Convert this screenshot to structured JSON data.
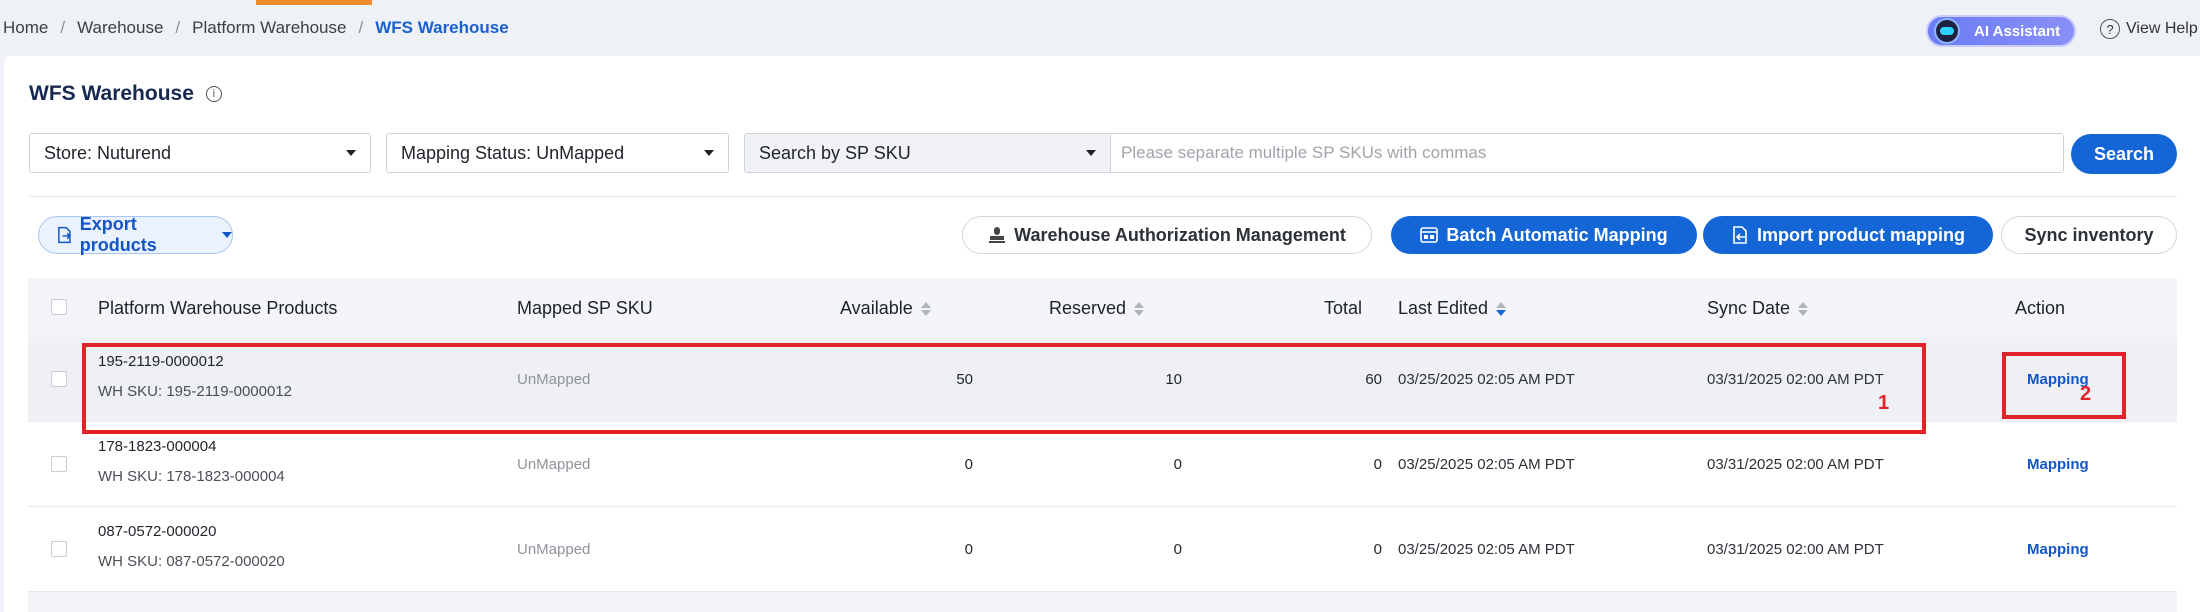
{
  "breadcrumb": {
    "items": [
      "Home",
      "Warehouse",
      "Platform Warehouse"
    ],
    "current": "WFS Warehouse"
  },
  "header": {
    "ai_assistant": "AI Assistant",
    "view_help": "View Help"
  },
  "page": {
    "title": "WFS Warehouse"
  },
  "filters": {
    "store": "Store: Nuturend",
    "mapping_status": "Mapping Status: UnMapped",
    "search_type": "Search by SP SKU",
    "search_placeholder": "Please separate multiple SP SKUs with commas",
    "search_button": "Search"
  },
  "toolbar": {
    "export": "Export products",
    "auth_mgmt": "Warehouse Authorization Management",
    "batch_mapping": "Batch Automatic Mapping",
    "import_mapping": "Import product mapping",
    "sync_inventory": "Sync inventory"
  },
  "table": {
    "headers": {
      "product": "Platform Warehouse Products",
      "mapped": "Mapped SP SKU",
      "available": "Available",
      "reserved": "Reserved",
      "total": "Total",
      "last_edited": "Last Edited",
      "sync_date": "Sync Date",
      "action": "Action"
    },
    "rows": [
      {
        "sku": "195-2119-0000012",
        "wh_sku": "WH SKU: 195-2119-0000012",
        "mapped": "UnMapped",
        "available": "50",
        "reserved": "10",
        "total": "60",
        "last_edited": "03/25/2025 02:05 AM PDT",
        "sync_date": "03/31/2025 02:00 AM PDT",
        "action": "Mapping"
      },
      {
        "sku": "178-1823-000004",
        "wh_sku": "WH SKU: 178-1823-000004",
        "mapped": "UnMapped",
        "available": "0",
        "reserved": "0",
        "total": "0",
        "last_edited": "03/25/2025 02:05 AM PDT",
        "sync_date": "03/31/2025 02:00 AM PDT",
        "action": "Mapping"
      },
      {
        "sku": "087-0572-000020",
        "wh_sku": "WH SKU: 087-0572-000020",
        "mapped": "UnMapped",
        "available": "0",
        "reserved": "0",
        "total": "0",
        "last_edited": "03/25/2025 02:05 AM PDT",
        "sync_date": "03/31/2025 02:00 AM PDT",
        "action": "Mapping"
      }
    ]
  },
  "annotations": [
    "1",
    "2"
  ],
  "colors": {
    "primary": "#1466d6",
    "accent_orange": "#f08c2b",
    "annotation_red": "#e2232a"
  }
}
